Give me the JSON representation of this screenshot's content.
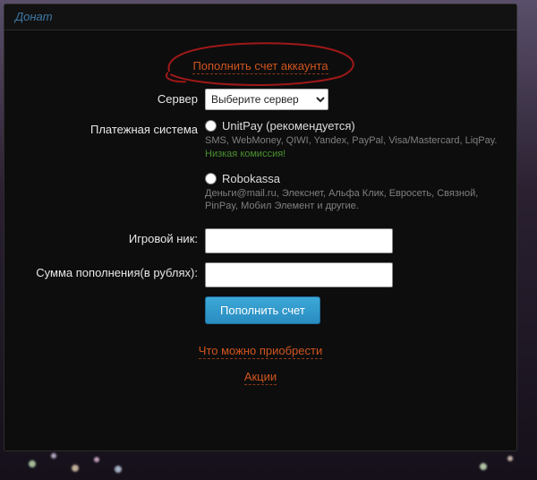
{
  "header_tab": "Донат",
  "title": "Пополнить счет аккаунта",
  "form": {
    "server": {
      "label": "Сервер",
      "placeholder": "Выберите сервер"
    },
    "payment_system": {
      "label": "Платежная система",
      "options": [
        {
          "name": "UnitPay (рекомендуется)",
          "desc": "SMS, WebMoney, QIWI, Yandex, PayPal, Visa/Mastercard, LiqPay.",
          "note": "Низкая комиссия!"
        },
        {
          "name": "Robokassa",
          "desc": "Деньги@mail.ru, Элекснет, Альфа Клик, Евросеть, Связной, PinPay, Мобил Элемент и другие."
        }
      ]
    },
    "nickname": {
      "label": "Игровой ник:",
      "value": ""
    },
    "amount": {
      "label": "Сумма пополнения(в рублях):",
      "value": ""
    },
    "submit": "Пополнить счет"
  },
  "links": {
    "buy": "Что можно приобрести",
    "promo": "Акции"
  }
}
